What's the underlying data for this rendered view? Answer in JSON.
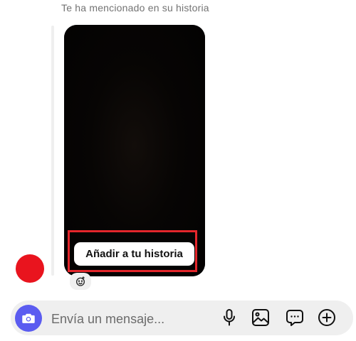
{
  "thread": {
    "mention_notice": "Te ha mencionado en su historia",
    "avatar_color": "#e9141e"
  },
  "story": {
    "add_to_story_label": "Añadir a tu historia",
    "highlight_color": "#e3262b"
  },
  "composer": {
    "placeholder": "Envía un mensaje...",
    "accent_color": "#5b5cf0",
    "icons": [
      "camera-icon",
      "microphone-icon",
      "image-icon",
      "sticker-icon",
      "plus-icon"
    ]
  }
}
